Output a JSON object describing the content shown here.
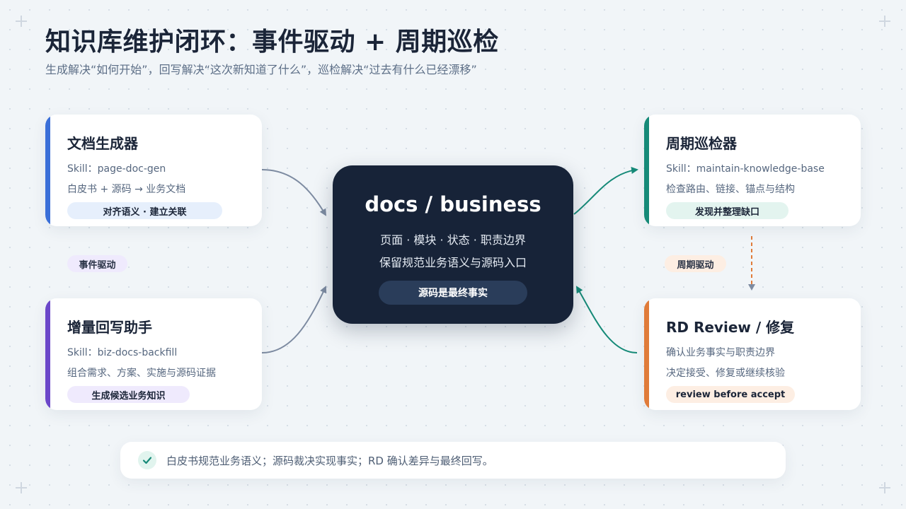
{
  "header": {
    "title": "知识库维护闭环：事件驱动 + 周期巡检",
    "subtitle": "生成解决“如何开始”，回写解决“这次新知道了什么”，巡检解决“过去有什么已经漂移”"
  },
  "cards": {
    "doc_generator": {
      "title": "文档生成器",
      "skill": "Skill：page-doc-gen",
      "desc": "白皮书 + 源码 → 业务文档",
      "badge": "对齐语义 · 建立关联",
      "accent": "#3a6fd8"
    },
    "backfill": {
      "title": "增量回写助手",
      "skill": "Skill：biz-docs-backfill",
      "desc": "组合需求、方案、实施与源码证据",
      "badge": "生成候选业务知识",
      "accent": "#6b47c9"
    },
    "inspector": {
      "title": "周期巡检器",
      "skill": "Skill：maintain-knowledge-base",
      "desc": "检查路由、链接、锚点与结构",
      "badge": "发现并整理缺口",
      "accent": "#168a78"
    },
    "review": {
      "title": "RD Review / 修复",
      "line1": "确认业务事实与职责边界",
      "line2": "决定接受、修复或继续核验",
      "badge": "review before accept",
      "accent": "#e07b39"
    }
  },
  "center": {
    "title": "docs / business",
    "line1": "页面 · 模块 · 状态 · 职责边界",
    "line2": "保留规范业务语义与源码入口",
    "badge": "源码是最终事实"
  },
  "tags": {
    "event_driven": "事件驱动",
    "periodic": "周期驱动"
  },
  "footer": {
    "icon": "check-icon",
    "text": "白皮书规范业务语义；源码裁决实现事实；RD 确认差异与最终回写。"
  }
}
